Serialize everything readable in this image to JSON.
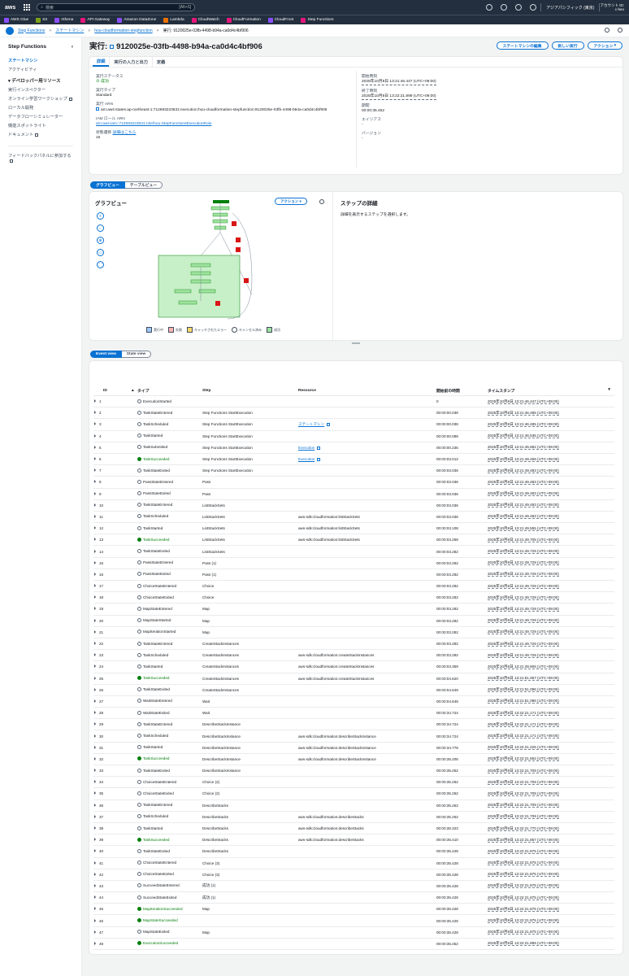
{
  "topnav": {
    "logo": "aws",
    "search_placeholder": "検索",
    "search_shortcut": "[Alt+S]",
    "region": "アジアパシフィック (東京)",
    "account": "アカウント ID:",
    "user": "c-heo"
  },
  "favorites": [
    {
      "label": "AWS Glue",
      "color": "#8c4fff"
    },
    {
      "label": "S3",
      "color": "#7aa116"
    },
    {
      "label": "Athena",
      "color": "#8c4fff"
    },
    {
      "label": "API Gateway",
      "color": "#e7157b"
    },
    {
      "label": "Amazon DataZone",
      "color": "#8c4fff"
    },
    {
      "label": "Lambda",
      "color": "#ed7100"
    },
    {
      "label": "CloudWatch",
      "color": "#e7157b"
    },
    {
      "label": "CloudFormation",
      "color": "#e7157b"
    },
    {
      "label": "CloudFront",
      "color": "#8c4fff"
    },
    {
      "label": "Step Functions",
      "color": "#e7157b"
    }
  ],
  "breadcrumb": {
    "items": [
      "Step Functions",
      "ステートマシン",
      "hou-cloudformation-stepfunction",
      "実行: 9120025e-03fb-4498-b94a-ca0d4c4bf906"
    ]
  },
  "sidebar": {
    "title": "Step Functions",
    "items": [
      "ステートマシン",
      "アクティビティ"
    ],
    "dev_section": "デベロッパー用リソース",
    "dev_items": [
      "実行インスペクター",
      "オンライン学習ワークショップ",
      "ローカル開発",
      "データフローシミュレーター",
      "機能スポットライト",
      "ドキュメント"
    ],
    "feedback": "フィードバックパネルに参加する"
  },
  "page": {
    "title_prefix": "実行:",
    "title": "9120025e-03fb-4498-b94a-ca0d4c4bf906",
    "buttons": {
      "edit": "ステートマシンの編集",
      "new": "新しい実行",
      "action": "アクション"
    }
  },
  "tabs": [
    "詳細",
    "実行の入力と出力",
    "定義"
  ],
  "details": {
    "status_label": "実行ステータス",
    "status": "成功",
    "type_label": "実行タイプ",
    "type": "Standard",
    "arn_label": "実行 ARN",
    "arn": "arn:aws:states:ap-northeast-1:712693223631:execution:hou-cloudformation-stepfunction:9120025e-03fb-4498-b94a-ca0d4c4bf906",
    "role_label": "IAM ロール ARN",
    "role": "arn:aws:iam::712693223631:role/hou-StepFunctionsExecutionRole",
    "trans_label": "状態遷移",
    "trans_link": "詳細はこちら",
    "trans": "15",
    "start_label": "開始時刻",
    "start": "2025年10月8日 13:21:46.447 (UTC+09:00)",
    "end_label": "終了時刻",
    "end": "2025年10月8日 13:22:21.899 (UTC+09:00)",
    "duration_label": "期間",
    "duration": "00:00:35.452",
    "alias_label": "エイリアス",
    "alias": "-",
    "version_label": "バージョン",
    "version": "-"
  },
  "views": {
    "graph": "グラフビュー",
    "table": "テーブルビュー"
  },
  "graph": {
    "title": "グラフビュー",
    "action": "アクション",
    "legend": [
      "実行中",
      "失敗",
      "キャッチされたエラー",
      "キャンセル済み",
      "成功"
    ]
  },
  "step_details": {
    "title": "ステップの詳細",
    "text": "詳細を表示するステップを選択します。"
  },
  "event_views": {
    "event": "Event view",
    "state": "State view"
  },
  "table": {
    "headers": [
      "ID",
      "タイプ",
      "Step",
      "Resource",
      "開始前の時間",
      "タイムスタンプ"
    ],
    "rows": [
      {
        "id": "1",
        "type": "ExecutionStarted",
        "ok": false,
        "step": "",
        "res": "",
        "link": false,
        "elapsed": "0",
        "ts": "2025年10月8日 13:21:46.447 (UTC+09:00)"
      },
      {
        "id": "2",
        "type": "TaskStateEntered",
        "ok": false,
        "step": "Step Functions StartExecution",
        "res": "",
        "link": false,
        "elapsed": "00:00:00.038",
        "ts": "2025年10月8日 13:21:46.485 (UTC+09:00)"
      },
      {
        "id": "3",
        "type": "TaskScheduled",
        "ok": false,
        "step": "Step Functions StartExecution",
        "res": "ステートマシン",
        "link": true,
        "elapsed": "00:00:00.038",
        "ts": "2025年10月8日 13:21:46.485 (UTC+09:00)"
      },
      {
        "id": "4",
        "type": "TaskStarted",
        "ok": false,
        "step": "Step Functions StartExecution",
        "res": "",
        "link": false,
        "elapsed": "00:00:00.088",
        "ts": "2025年10月8日 13:21:46.535 (UTC+09:00)"
      },
      {
        "id": "5",
        "type": "TaskSubmitted",
        "ok": false,
        "step": "Step Functions StartExecution",
        "res": "Execution",
        "link": true,
        "elapsed": "00:00:00.235",
        "ts": "2025年10月8日 13:21:46.682 (UTC+09:00)"
      },
      {
        "id": "6",
        "type": "TaskSucceeded",
        "ok": true,
        "step": "Step Functions StartExecution",
        "res": "Execution",
        "link": true,
        "elapsed": "00:00:03.012",
        "ts": "2025年10月8日 13:21:49.459 (UTC+09:00)"
      },
      {
        "id": "7",
        "type": "TaskStateExited",
        "ok": false,
        "step": "Step Functions StartExecution",
        "res": "",
        "link": false,
        "elapsed": "00:00:03.036",
        "ts": "2025年10月8日 13:21:49.483 (UTC+09:00)"
      },
      {
        "id": "8",
        "type": "PassStateEntered",
        "ok": false,
        "step": "Pass",
        "res": "",
        "link": false,
        "elapsed": "00:00:03.036",
        "ts": "2025年10月8日 13:21:49.483 (UTC+09:00)"
      },
      {
        "id": "9",
        "type": "PassStateExited",
        "ok": false,
        "step": "Pass",
        "res": "",
        "link": false,
        "elapsed": "00:00:03.036",
        "ts": "2025年10月8日 13:21:49.483 (UTC+09:00)"
      },
      {
        "id": "10",
        "type": "TaskStateEntered",
        "ok": false,
        "step": "ListStackSets",
        "res": "",
        "link": false,
        "elapsed": "00:00:03.036",
        "ts": "2025年10月8日 13:21:49.483 (UTC+09:00)"
      },
      {
        "id": "11",
        "type": "TaskScheduled",
        "ok": false,
        "step": "ListStackSets",
        "res": "aws-sdk:cloudformation:listStackSets",
        "link": false,
        "elapsed": "00:00:03.036",
        "ts": "2025年10月8日 13:21:49.483 (UTC+09:00)"
      },
      {
        "id": "12",
        "type": "TaskStarted",
        "ok": false,
        "step": "ListStackSets",
        "res": "aws-sdk:cloudformation:listStackSets",
        "link": false,
        "elapsed": "00:00:03.108",
        "ts": "2025年10月8日 13:21:49.555 (UTC+09:00)"
      },
      {
        "id": "13",
        "type": "TaskSucceeded",
        "ok": true,
        "step": "ListStackSets",
        "res": "aws-sdk:cloudformation:listStackSets",
        "link": false,
        "elapsed": "00:00:03.258",
        "ts": "2025年10月8日 13:21:49.705 (UTC+09:00)"
      },
      {
        "id": "14",
        "type": "TaskStateExited",
        "ok": false,
        "step": "ListStackSets",
        "res": "",
        "link": false,
        "elapsed": "00:00:03.282",
        "ts": "2025年10月8日 13:21:49.729 (UTC+09:00)"
      },
      {
        "id": "15",
        "type": "PassStateEntered",
        "ok": false,
        "step": "Pass (1)",
        "res": "",
        "link": false,
        "elapsed": "00:00:03.282",
        "ts": "2025年10月8日 13:21:49.729 (UTC+09:00)"
      },
      {
        "id": "16",
        "type": "PassStateExited",
        "ok": false,
        "step": "Pass (1)",
        "res": "",
        "link": false,
        "elapsed": "00:00:03.282",
        "ts": "2025年10月8日 13:21:49.729 (UTC+09:00)"
      },
      {
        "id": "17",
        "type": "ChoiceStateEntered",
        "ok": false,
        "step": "Choice",
        "res": "",
        "link": false,
        "elapsed": "00:00:03.282",
        "ts": "2025年10月8日 13:21:49.729 (UTC+09:00)"
      },
      {
        "id": "18",
        "type": "ChoiceStateExited",
        "ok": false,
        "step": "Choice",
        "res": "",
        "link": false,
        "elapsed": "00:00:03.282",
        "ts": "2025年10月8日 13:21:49.729 (UTC+09:00)"
      },
      {
        "id": "19",
        "type": "MapStateEntered",
        "ok": false,
        "step": "Map",
        "res": "",
        "link": false,
        "elapsed": "00:00:03.282",
        "ts": "2025年10月8日 13:21:49.729 (UTC+09:00)"
      },
      {
        "id": "20",
        "type": "MapStateStarted",
        "ok": false,
        "step": "Map",
        "res": "",
        "link": false,
        "elapsed": "00:00:03.282",
        "ts": "2025年10月8日 13:21:49.729 (UTC+09:00)"
      },
      {
        "id": "21",
        "type": "MapIterationStarted",
        "ok": false,
        "step": "Map",
        "res": "",
        "link": false,
        "elapsed": "00:00:03.282",
        "ts": "2025年10月8日 13:21:49.729 (UTC+09:00)"
      },
      {
        "id": "22",
        "type": "TaskStateEntered",
        "ok": false,
        "step": "CreateStackInstances",
        "res": "",
        "link": false,
        "elapsed": "00:00:03.282",
        "ts": "2025年10月8日 13:21:49.729 (UTC+09:00)"
      },
      {
        "id": "23",
        "type": "TaskScheduled",
        "ok": false,
        "step": "CreateStackInstances",
        "res": "aws-sdk:cloudformation:createStackInstances",
        "link": false,
        "elapsed": "00:00:03.282",
        "ts": "2025年10月8日 13:21:49.729 (UTC+09:00)"
      },
      {
        "id": "24",
        "type": "TaskStarted",
        "ok": false,
        "step": "CreateStackInstances",
        "res": "aws-sdk:cloudformation:createStackInstances",
        "link": false,
        "elapsed": "00:00:03.359",
        "ts": "2025年10月8日 13:21:49.806 (UTC+09:00)"
      },
      {
        "id": "25",
        "type": "TaskSucceeded",
        "ok": true,
        "step": "CreateStackInstances",
        "res": "aws-sdk:cloudformation:createStackInstances",
        "link": false,
        "elapsed": "00:00:04.620",
        "ts": "2025年10月8日 13:21:51.067 (UTC+09:00)"
      },
      {
        "id": "26",
        "type": "TaskStateExited",
        "ok": false,
        "step": "CreateStackInstances",
        "res": "",
        "link": false,
        "elapsed": "00:00:04.649",
        "ts": "2025年10月8日 13:21:51.096 (UTC+09:00)"
      },
      {
        "id": "27",
        "type": "WaitStateEntered",
        "ok": false,
        "step": "Wait",
        "res": "",
        "link": false,
        "elapsed": "00:00:04.649",
        "ts": "2025年10月8日 13:21:51.096 (UTC+09:00)"
      },
      {
        "id": "28",
        "type": "WaitStateExited",
        "ok": false,
        "step": "Wait",
        "res": "",
        "link": false,
        "elapsed": "00:00:34.724",
        "ts": "2025年10月8日 13:22:21.171 (UTC+09:00)"
      },
      {
        "id": "29",
        "type": "TaskStateEntered",
        "ok": false,
        "step": "DescribeStackInstance",
        "res": "",
        "link": false,
        "elapsed": "00:00:34.724",
        "ts": "2025年10月8日 13:22:21.171 (UTC+09:00)"
      },
      {
        "id": "30",
        "type": "TaskScheduled",
        "ok": false,
        "step": "DescribeStackInstance",
        "res": "aws-sdk:cloudformation:describeStackInstance",
        "link": false,
        "elapsed": "00:00:34.724",
        "ts": "2025年10月8日 13:22:21.171 (UTC+09:00)"
      },
      {
        "id": "31",
        "type": "TaskStarted",
        "ok": false,
        "step": "DescribeStackInstance",
        "res": "aws-sdk:cloudformation:describeStackInstance",
        "link": false,
        "elapsed": "00:00:34.778",
        "ts": "2025年10月8日 13:22:21.225 (UTC+09:00)"
      },
      {
        "id": "32",
        "type": "TaskSucceeded",
        "ok": true,
        "step": "DescribeStackInstance",
        "res": "aws-sdk:cloudformation:describeStackInstance",
        "link": false,
        "elapsed": "00:00:35.205",
        "ts": "2025年10月8日 13:22:21.652 (UTC+09:00)"
      },
      {
        "id": "33",
        "type": "TaskStateExited",
        "ok": false,
        "step": "DescribeStackInstance",
        "res": "",
        "link": false,
        "elapsed": "00:00:35.262",
        "ts": "2025年10月8日 13:22:21.709 (UTC+09:00)"
      },
      {
        "id": "34",
        "type": "ChoiceStateEntered",
        "ok": false,
        "step": "Choice (2)",
        "res": "",
        "link": false,
        "elapsed": "00:00:35.262",
        "ts": "2025年10月8日 13:22:21.709 (UTC+09:00)"
      },
      {
        "id": "35",
        "type": "ChoiceStateExited",
        "ok": false,
        "step": "Choice (2)",
        "res": "",
        "link": false,
        "elapsed": "00:00:35.262",
        "ts": "2025年10月8日 13:22:21.709 (UTC+09:00)"
      },
      {
        "id": "36",
        "type": "TaskStateEntered",
        "ok": false,
        "step": "DescribeStacks",
        "res": "",
        "link": false,
        "elapsed": "00:00:35.262",
        "ts": "2025年10月8日 13:22:21.709 (UTC+09:00)"
      },
      {
        "id": "37",
        "type": "TaskScheduled",
        "ok": false,
        "step": "DescribeStacks",
        "res": "aws-sdk:cloudformation:describeStacks",
        "link": false,
        "elapsed": "00:00:35.262",
        "ts": "2025年10月8日 13:22:21.709 (UTC+09:00)"
      },
      {
        "id": "38",
        "type": "TaskStarted",
        "ok": false,
        "step": "DescribeStacks",
        "res": "aws-sdk:cloudformation:describeStacks",
        "link": false,
        "elapsed": "00:00:35.323",
        "ts": "2025年10月8日 13:22:21.770 (UTC+09:00)"
      },
      {
        "id": "39",
        "type": "TaskSucceeded",
        "ok": true,
        "step": "DescribeStacks",
        "res": "aws-sdk:cloudformation:describeStacks",
        "link": false,
        "elapsed": "00:00:35.410",
        "ts": "2025年10月8日 13:22:21.857 (UTC+09:00)"
      },
      {
        "id": "40",
        "type": "TaskStateExited",
        "ok": false,
        "step": "DescribeStacks",
        "res": "",
        "link": false,
        "elapsed": "00:00:35.428",
        "ts": "2025年10月8日 13:22:21.875 (UTC+09:00)"
      },
      {
        "id": "41",
        "type": "ChoiceStateEntered",
        "ok": false,
        "step": "Choice (3)",
        "res": "",
        "link": false,
        "elapsed": "00:00:35.428",
        "ts": "2025年10月8日 13:22:21.875 (UTC+09:00)"
      },
      {
        "id": "42",
        "type": "ChoiceStateExited",
        "ok": false,
        "step": "Choice (3)",
        "res": "",
        "link": false,
        "elapsed": "00:00:35.428",
        "ts": "2025年10月8日 13:22:21.875 (UTC+09:00)"
      },
      {
        "id": "43",
        "type": "SucceedStateEntered",
        "ok": false,
        "step": "成功 (1)",
        "res": "",
        "link": false,
        "elapsed": "00:00:35.428",
        "ts": "2025年10月8日 13:22:21.875 (UTC+09:00)"
      },
      {
        "id": "44",
        "type": "SucceedStateExited",
        "ok": false,
        "step": "成功 (1)",
        "res": "",
        "link": false,
        "elapsed": "00:00:35.428",
        "ts": "2025年10月8日 13:22:21.875 (UTC+09:00)"
      },
      {
        "id": "45",
        "type": "MapIterationSucceeded",
        "ok": true,
        "step": "Map",
        "res": "",
        "link": false,
        "elapsed": "00:00:35.428",
        "ts": "2025年10月8日 13:22:21.875 (UTC+09:00)"
      },
      {
        "id": "46",
        "type": "MapStateSucceeded",
        "ok": true,
        "step": "",
        "res": "",
        "link": false,
        "elapsed": "00:00:35.428",
        "ts": "2025年10月8日 13:22:21.875 (UTC+09:00)"
      },
      {
        "id": "47",
        "type": "MapStateExited",
        "ok": false,
        "step": "Map",
        "res": "",
        "link": false,
        "elapsed": "00:00:35.428",
        "ts": "2025年10月8日 13:22:21.875 (UTC+09:00)"
      },
      {
        "id": "48",
        "type": "ExecutionSucceeded",
        "ok": true,
        "step": "",
        "res": "",
        "link": false,
        "elapsed": "00:00:35.452",
        "ts": "2025年10月8日 13:22:21.899 (UTC+09:00)"
      }
    ]
  }
}
